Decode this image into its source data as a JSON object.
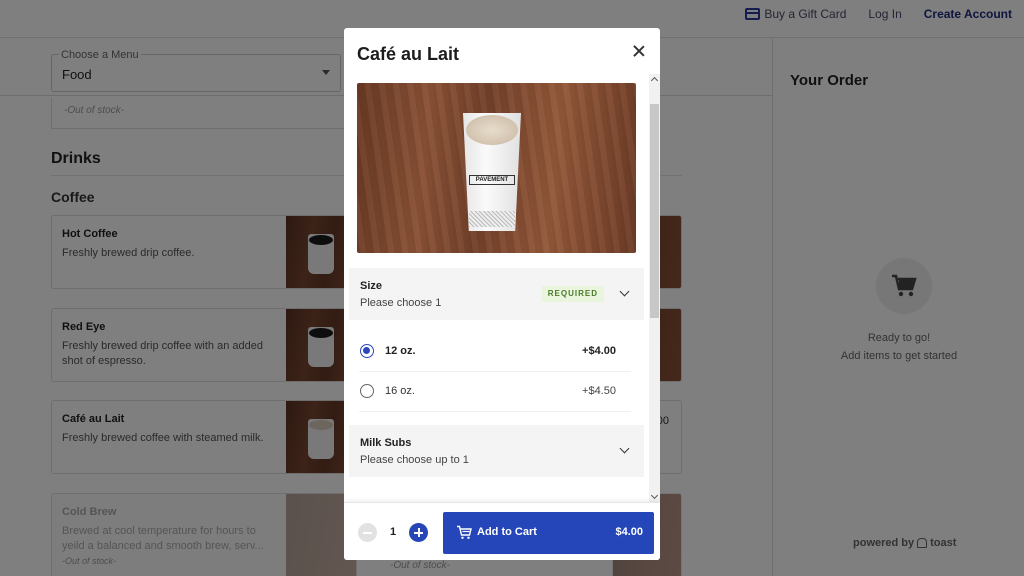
{
  "topnav": {
    "gift_card": "Buy a Gift Card",
    "login": "Log In",
    "create_account": "Create Account"
  },
  "menu_select": {
    "label": "Choose a Menu",
    "value": "Food"
  },
  "out_of_stock_label": "-Out of stock-",
  "sections": {
    "drinks": "Drinks",
    "coffee": "Coffee"
  },
  "items": [
    {
      "name": "Hot Coffee",
      "description": "Freshly brewed drip coffee."
    },
    {
      "name": "Red Eye",
      "description": "Freshly brewed drip coffee with an added shot of espresso."
    },
    {
      "name": "Café au Lait",
      "description": "Freshly brewed coffee with steamed milk."
    },
    {
      "name": "Cold Brew",
      "description": "Brewed at cool temperature for hours to yeild a balanced and smooth brew, serv...",
      "status": "-Out of stock-"
    }
  ],
  "partial_right_price": "00",
  "order": {
    "title": "Your Order",
    "empty_line1": "Ready to go!",
    "empty_line2": "Add items to get started",
    "powered_by": "powered by",
    "brand": "toast"
  },
  "modal": {
    "title": "Café au Lait",
    "cup_brand": "PAVEMENT",
    "groups": [
      {
        "name": "Size",
        "subtitle": "Please choose 1",
        "badge": "REQUIRED",
        "options": [
          {
            "name": "12 oz.",
            "price": "+$4.00",
            "selected": true
          },
          {
            "name": "16 oz.",
            "price": "+$4.50",
            "selected": false
          }
        ]
      },
      {
        "name": "Milk Subs",
        "subtitle": "Please choose up to 1"
      }
    ],
    "quantity": "1",
    "add_to_cart": "Add to Cart",
    "total": "$4.00"
  },
  "colors": {
    "accent": "#2446b8",
    "required_bg": "#e9f6dd",
    "required_text": "#4a7a2a"
  }
}
